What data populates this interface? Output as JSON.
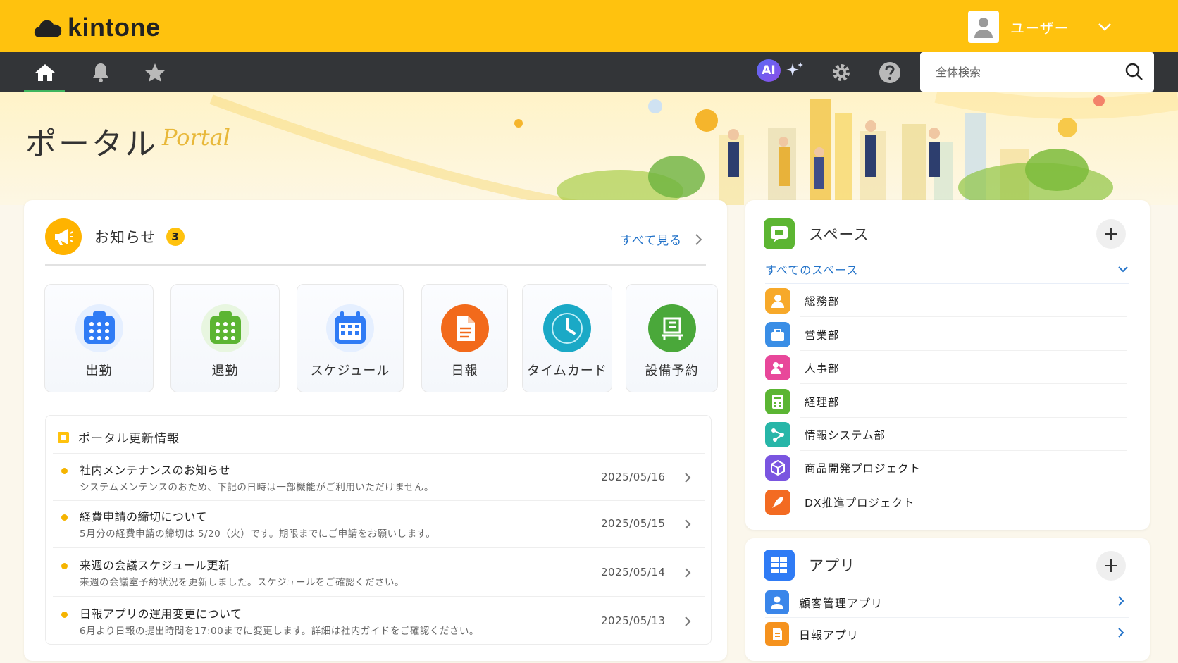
{
  "header": {
    "logo_text": "kintone",
    "user_name": "ユーザー"
  },
  "nav": {
    "ai_label": "AI",
    "search_placeholder": "全体検索"
  },
  "hero": {
    "title": "ポータル",
    "script": "Portal"
  },
  "notices": {
    "title": "お知らせ",
    "count": "3",
    "see_all": "すべて見る"
  },
  "shortcuts": [
    {
      "label": "出勤",
      "icon": "calendar-icon",
      "color": "#2f7bf5"
    },
    {
      "label": "退勤",
      "icon": "calendar-icon",
      "color": "#5cb532"
    },
    {
      "label": "スケジュール",
      "icon": "calendar-icon",
      "color": "#2f7bf5"
    },
    {
      "label": "日報",
      "icon": "document-icon",
      "color": "#f26a1b"
    },
    {
      "label": "タイムカード",
      "icon": "clock-icon",
      "color": "#1aa9c6"
    },
    {
      "label": "設備予約",
      "icon": "building-icon",
      "color": "#4aa83a"
    }
  ],
  "updates": {
    "title": "ポータル更新情報",
    "items": [
      {
        "title": "社内メンテナンスのお知らせ",
        "body": "システムメンテンスのおため、下記の日時は一部機能がご利用いただけません。",
        "date": "2025/05/16"
      },
      {
        "title": "経費申請の締切について",
        "body": "5月分の経費申請の締切は 5/20（火）です。期限までにご申請をお願いします。",
        "date": "2025/05/15"
      },
      {
        "title": "来週の会議スケジュール更新",
        "body": "来週の会議室予約状況を更新しました。スケジュールをご確認ください。",
        "date": "2025/05/14"
      },
      {
        "title": "日報アプリの運用変更について",
        "body": "6月より日報の提出時間を17:00までに変更します。詳細は社内ガイドをご確認ください。",
        "date": "2025/05/13"
      }
    ]
  },
  "spaces": {
    "title": "スペース",
    "all_label": "すべてのスペース",
    "items": [
      {
        "label": "総務部",
        "icon": "users-icon",
        "color": "#f7a92a"
      },
      {
        "label": "営業部",
        "icon": "bag-icon",
        "color": "#3a8ee6"
      },
      {
        "label": "人事部",
        "icon": "people-icon",
        "color": "#e8479a"
      },
      {
        "label": "経理部",
        "icon": "calculator-icon",
        "color": "#5bb533"
      },
      {
        "label": "情報システム部",
        "icon": "network-icon",
        "color": "#27b6a8"
      },
      {
        "label": "商品開発プロジェクト",
        "icon": "cube-icon",
        "color": "#7a55e0"
      },
      {
        "label": "DX推進プロジェクト",
        "icon": "rocket-icon",
        "color": "#f36b22"
      }
    ]
  },
  "apps": {
    "title": "アプリ",
    "items": [
      {
        "label": "顧客管理アプリ",
        "icon": "user-icon",
        "color": "#3a86ea"
      },
      {
        "label": "日報アプリ",
        "icon": "document-icon",
        "color": "#f5921e"
      }
    ]
  }
}
